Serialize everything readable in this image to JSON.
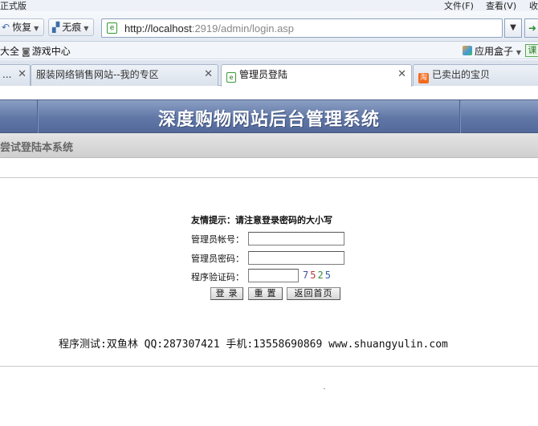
{
  "window": {
    "title_fragment": "正式版",
    "menus": [
      "文件(F)",
      "查看(V)",
      "收"
    ]
  },
  "nav": {
    "back_label": "恢复",
    "trace_label": "无痕",
    "url_host": "http://localhost",
    "url_rest": ":2919/admin/login.asp",
    "page_icon": "e",
    "go_icon": "➜"
  },
  "favorites": {
    "item1": "大全",
    "item2": "游戏中心",
    "apps": "应用盒子",
    "green_icon": "课"
  },
  "tabs": [
    {
      "label": "...",
      "close": "✕"
    },
    {
      "label": "服装网络销售网站--我的专区",
      "close": "✕"
    },
    {
      "label": "管理员登陆",
      "close": "✕"
    },
    {
      "label": "已卖出的宝贝"
    }
  ],
  "page": {
    "banner_title": "深度购物网站后台管理系统",
    "subbar_text": "尝试登陆本系统",
    "tip": "友情提示：请注意登录密码的大小写",
    "username_label": "管理员帐号：",
    "password_label": "管理员密码：",
    "code_label": "程序验证码：",
    "captcha": [
      "7",
      "5",
      "2",
      "5"
    ],
    "buttons": {
      "login": "登 录",
      "reset": "重 置",
      "home": "返回首页"
    },
    "footer": "程序测试:双鱼林 QQ:287307421 手机:13558690869 www.shuangyulin.com"
  },
  "colors": {
    "banner": "#6077a6",
    "subbar": "#d9d9d9"
  }
}
